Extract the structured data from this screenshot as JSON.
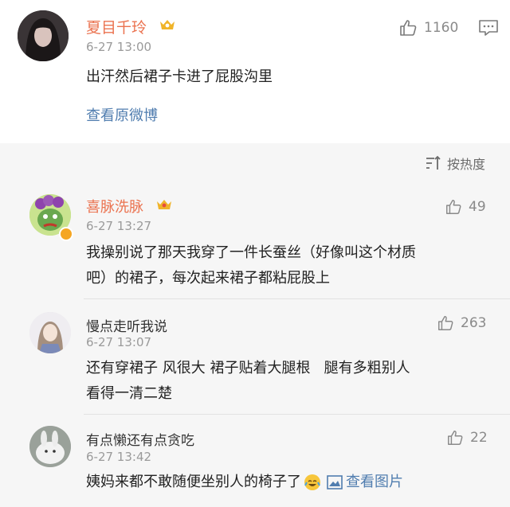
{
  "post": {
    "author": "夏目千玲",
    "time": "6-27 13:00",
    "text": "出汗然后裙子卡进了屁股沟里",
    "view_link": "查看原微博",
    "likes": "1160"
  },
  "sort_label": "按热度",
  "comments": [
    {
      "author": "喜脉洗脉",
      "time": "6-27 13:27",
      "likes": "49",
      "line1": "我操别说了那天我穿了一件长蚕丝（好像叫这个材质",
      "line2": "吧）的裙子，每次起来裙子都粘屁股上"
    },
    {
      "author": "慢点走听我说",
      "time": "6-27 13:07",
      "likes": "263",
      "line1": "还有穿裙子 风很大 裙子贴着大腿根   腿有多粗别人",
      "line2": "看得一清二楚"
    },
    {
      "author": "有点懒还有点贪吃",
      "time": "6-27 13:42",
      "likes": "22",
      "line1": "姨妈来都不敢随便坐别人的椅子了",
      "image_link": "查看图片"
    }
  ]
}
